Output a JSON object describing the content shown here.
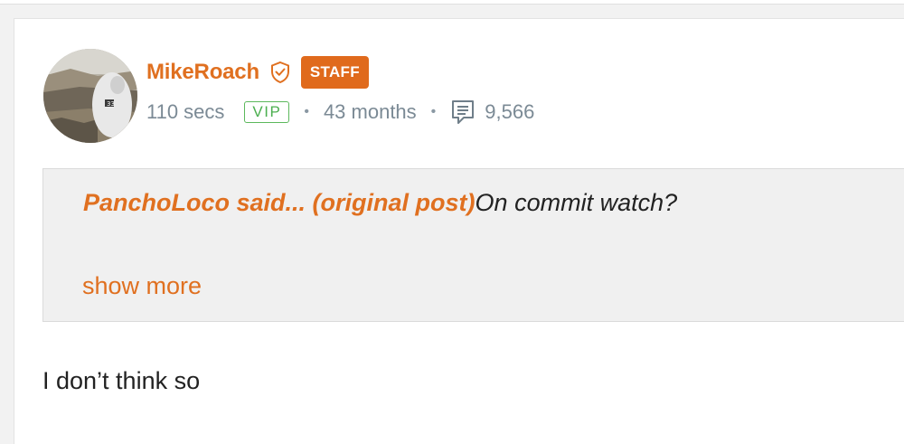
{
  "post": {
    "author": {
      "name": "MikeRoach",
      "verified_icon": "shield-check-icon",
      "role_badge": "STAFF",
      "avatar": "avatar-image"
    },
    "meta": {
      "online": "110 secs",
      "vip_badge": "VIP",
      "member_for": "43 months",
      "comments_icon": "comments-icon",
      "post_count": "9,566"
    },
    "quote": {
      "author_said": "PanchoLoco said...",
      "open_paren": " (",
      "link_text": "original post",
      "close_paren": ")",
      "text": "On commit watch?",
      "show_more": "show more"
    },
    "body": "I don’t think so"
  },
  "colors": {
    "accent": "#e07020",
    "staff_badge_bg": "#e06a1c",
    "vip_green": "#4caf50",
    "meta_gray": "#7b8a95",
    "quote_bg": "#f0f0f0"
  }
}
